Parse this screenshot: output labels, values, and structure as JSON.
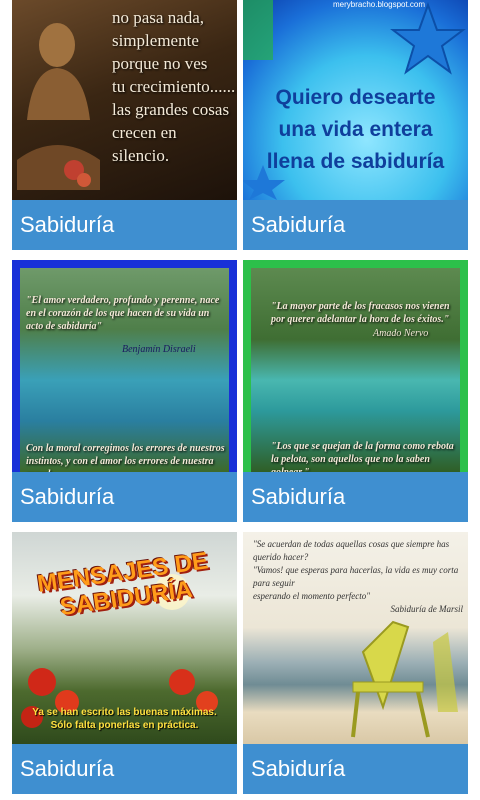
{
  "cards": [
    {
      "label": "Sabiduría",
      "quote_lines": [
        "no pasa nada,",
        "simplemente",
        "porque no ves",
        "tu crecimiento......",
        "las grandes cosas",
        "crecen en silencio."
      ]
    },
    {
      "label": "Sabiduría",
      "blog": "merybracho.blogspot.com",
      "quote_lines": [
        "Quiero desearte",
        "una vida entera",
        "llena de sabiduría"
      ]
    },
    {
      "label": "Sabiduría",
      "quote_top": "\"El amor verdadero, profundo y perenne, nace en el corazón de los que hacen de su vida un acto de sabiduría\"",
      "author": "Benjamín Disraeli",
      "quote_bottom": "Con la moral corregimos los errores de nuestros instintos, y con el amor los errores de nuestra moral"
    },
    {
      "label": "Sabiduría",
      "quote_top": "\"La mayor parte de los fracasos nos vienen por querer adelantar la hora de los éxitos.\"",
      "author": "Amado Nervo",
      "quote_bottom": "\"Los que se quejan de la forma como rebota la pelota, son aquellos que no la saben golpear.\""
    },
    {
      "label": "Sabiduría",
      "title_lines": [
        "MENSAJES DE",
        "SABIDURÍA"
      ],
      "quote_lines": [
        "Ya se han escrito las buenas máximas.",
        "Sólo falta ponerlas en práctica."
      ]
    },
    {
      "label": "Sabiduría",
      "quote_lines": [
        "\"Se acuerdan de todas aquellas cosas que siempre has querido hacer?",
        "\"Vamos! que esperas para hacerlas, la vida es muy corta para seguir",
        "esperando el momento perfecto\""
      ],
      "author": "Sabiduría de Marsil"
    }
  ]
}
